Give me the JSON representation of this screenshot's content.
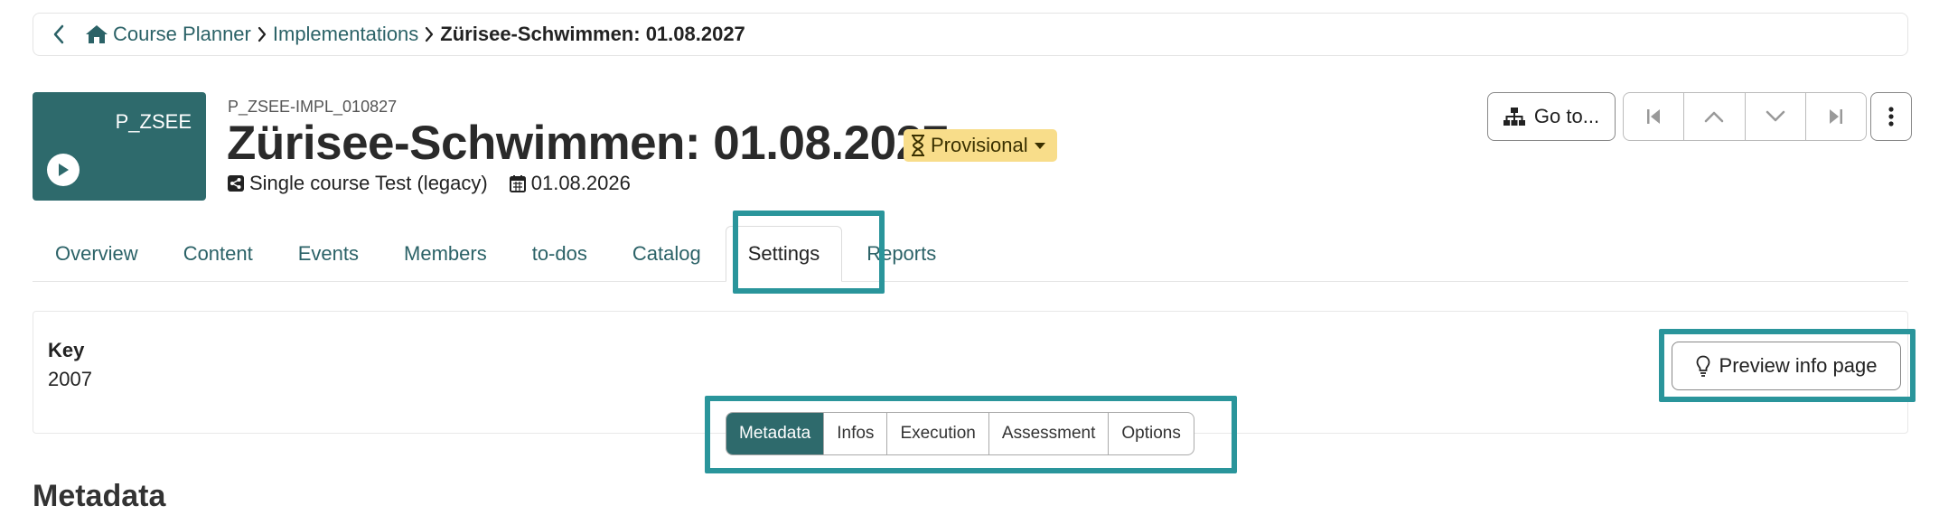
{
  "breadcrumb": {
    "items": [
      "Course Planner",
      "Implementations"
    ],
    "current": "Zürisee-Schwimmen: 01.08.2027"
  },
  "course": {
    "thumbnail_label": "P_ZSEE",
    "external_ref": "P_ZSEE-IMPL_010827",
    "title": "Zürisee-Schwimmen: 01.08.2027",
    "status": "Provisional",
    "type": "Single course Test (legacy)",
    "date": "01.08.2026"
  },
  "header_actions": {
    "goto_label": "Go to...",
    "nav_icons": [
      "first-icon",
      "previous-icon",
      "next-icon",
      "last-icon"
    ],
    "more_icon": "more-vertical-icon"
  },
  "tabs": [
    "Overview",
    "Content",
    "Events",
    "Members",
    "to-dos",
    "Catalog",
    "Settings",
    "Reports"
  ],
  "active_tab": "Settings",
  "key_panel": {
    "label": "Key",
    "value": "2007"
  },
  "preview_button": {
    "label": "Preview info page",
    "icon": "lightbulb-icon"
  },
  "settings_tabs": [
    "Metadata",
    "Infos",
    "Execution",
    "Assessment",
    "Options"
  ],
  "active_settings_tab": "Metadata",
  "section_title": "Metadata",
  "colors": {
    "accent": "#2e6a6c",
    "link": "#2b6267",
    "highlight": "#2a959b",
    "status_bg": "#f8dd8a"
  }
}
